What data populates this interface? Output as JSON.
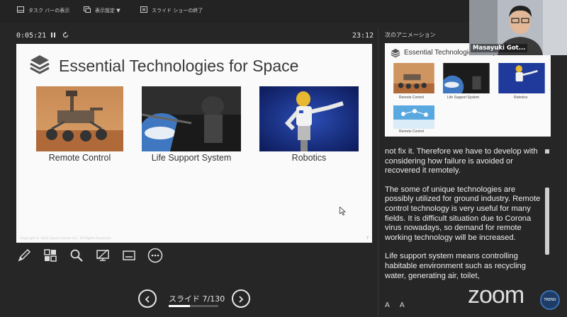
{
  "toolbar": {
    "taskbar_label": "タスク バーの表示",
    "display_settings_label": "表示設定 ▼",
    "end_show_label": "スライド ショーの終了"
  },
  "timer": "0:05:21",
  "clock": "23:12",
  "slide": {
    "title": "Essential Technologies for Space",
    "captions": [
      "Remote Control",
      "Life Support System",
      "Robotics"
    ],
    "copyright": "Copyright © 2021 Space Comm LLC. All Rights Reserved",
    "page_number": "7"
  },
  "nav": {
    "counter": "スライド 7/130",
    "current": 7,
    "total": 130
  },
  "next_panel": {
    "label": "次のアニメーション",
    "title": "Essential Technologies for Space",
    "captions": [
      "Remote Control",
      "Life Support System",
      "Robotics",
      "Remote Control"
    ]
  },
  "notes": {
    "paragraphs": [
      "not fix it. Therefore we have to develop with considering how failure is avoided or recovered it remotely.",
      "The some of unique technologies are possibly utilized for ground industry. Remote control technology is very useful for many fields. It is difficult situation due to Corona virus nowadays, so demand for remote working technology will be increased.",
      "Life support system means controlling habitable environment such as recycling water, generating air, toilet,"
    ]
  },
  "font_controls": [
    "A",
    "A"
  ],
  "participant": {
    "name": "Masayuki Got..."
  },
  "zoom_logo": "zoom",
  "channel_badge": "TREND"
}
